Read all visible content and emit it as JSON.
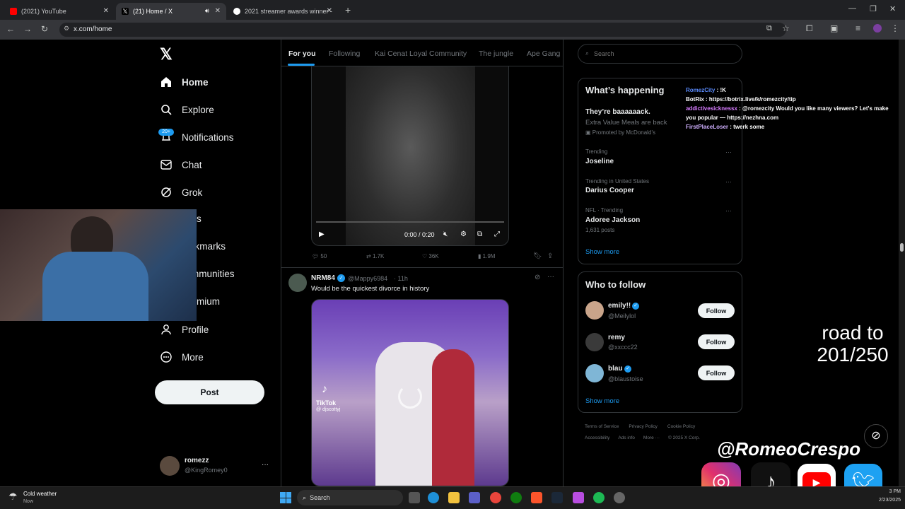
{
  "browser": {
    "tabs": [
      {
        "title": "(2021) YouTube",
        "active": false
      },
      {
        "title": "(21) Home / X",
        "active": true
      },
      {
        "title": "2021 streamer awards winner -",
        "active": false
      }
    ],
    "url": "x.com/home"
  },
  "nav": {
    "home": "Home",
    "explore": "Explore",
    "notifications": "Notifications",
    "notif_badge": "20+",
    "chat": "Chat",
    "grok": "Grok",
    "lists_partial": "s",
    "bookmarks_partial": "okmarks",
    "communities_partial": "mmunities",
    "premium_partial": "mium",
    "profile": "Profile",
    "more": "More",
    "post": "Post"
  },
  "account": {
    "name": "romezz",
    "handle": "@KingRomey0"
  },
  "feed_tabs": [
    "For you",
    "Following",
    "Kai Cenat Loyal Community",
    "The jungle",
    "Ape Gang"
  ],
  "video": {
    "time": "0:00 / 0:20",
    "progress": 0.0
  },
  "post1_actions": {
    "replies": "50",
    "reposts": "1.7K",
    "likes": "36K",
    "views": "1.9M"
  },
  "post2": {
    "name": "NRM84",
    "handle": "@Mappy6984",
    "time": "· 11h",
    "text": "Would be the quickest divorce in history",
    "tiktok_label": "TikTok",
    "tiktok_user": "@ djscottyj"
  },
  "search": {
    "placeholder": "Search"
  },
  "happening": {
    "title": "What’s happening",
    "promo_title": "They’re baaaaaack.",
    "promo_sub": "Extra Value Meals are back",
    "promo_by": "Promoted by McDonald’s",
    "trends": [
      {
        "context": "Trending",
        "name": "Joseline",
        "posts": ""
      },
      {
        "context": "Trending in United States",
        "name": "Darius Cooper",
        "posts": ""
      },
      {
        "context": "NFL · Trending",
        "name": "Adoree Jackson",
        "posts": "1,631 posts"
      }
    ],
    "show_more": "Show more"
  },
  "who_to_follow": {
    "title": "Who to follow",
    "users": [
      {
        "name": "emily!!",
        "handle": "@Meilylol",
        "button": "Follow"
      },
      {
        "name": "remy",
        "handle": "@xxccc22",
        "button": "Follow"
      },
      {
        "name": "blau",
        "handle": "@blaustoise",
        "button": "Follow"
      }
    ],
    "show_more": "Show more"
  },
  "footer": {
    "links1": [
      "Terms of Service",
      "Privacy Policy",
      "Cookie Policy"
    ],
    "links2": [
      "Accessibility",
      "Ads info",
      "More ···",
      "© 2025 X Corp."
    ]
  },
  "stream_chat": [
    {
      "user": "RomezCity",
      "color": "#5b8cff",
      "msg": ": !K"
    },
    {
      "user": "BotRix",
      "color": "#ffffff",
      "msg": ": https://botrix.live/k/romezcity/tip"
    },
    {
      "user": "addictivesicknessx",
      "color": "#d67bff",
      "msg": ": @romezcity Would you like many viewers? Let's make you popular — https://nezhna.com"
    },
    {
      "user": "FirstPlaceLoser",
      "color": "#d0b0ff",
      "msg": ": twerk some"
    }
  ],
  "overlay": {
    "goal_line1": "road to",
    "goal_line2": "201/250",
    "handle": "@RomeoCrespo"
  },
  "taskbar": {
    "weather_title": "Cold weather",
    "weather_sub": "Now",
    "search": "Search",
    "time_partial": "3 PM",
    "date_partial": "2/23/2025"
  }
}
